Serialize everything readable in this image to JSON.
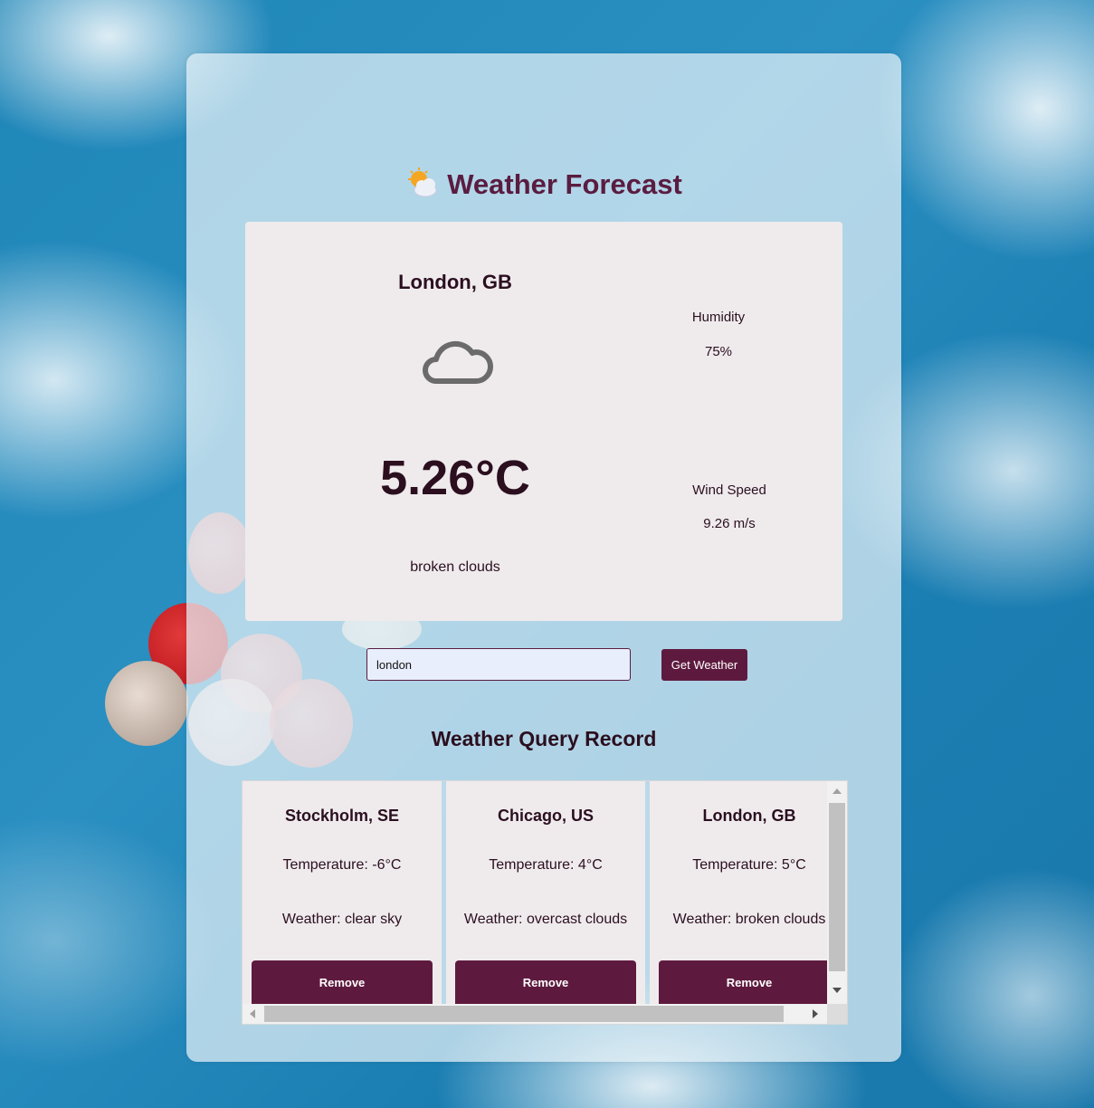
{
  "app": {
    "title": "Weather Forecast",
    "title_icon": "sun-behind-cloud-icon"
  },
  "current": {
    "city": "London, GB",
    "icon": "cloud-icon",
    "temperature": "5.26°C",
    "description": "broken clouds",
    "humidity_label": "Humidity",
    "humidity_value": "75%",
    "wind_label": "Wind Speed",
    "wind_value": "9.26 m/s"
  },
  "search": {
    "value": "london",
    "button_label": "Get Weather"
  },
  "records": {
    "title": "Weather Query Record",
    "items": [
      {
        "city": "Stockholm, SE",
        "temperature": "Temperature: -6°C",
        "weather": "Weather: clear sky",
        "remove_label": "Remove"
      },
      {
        "city": "Chicago, US",
        "temperature": "Temperature: 4°C",
        "weather": "Weather: overcast clouds",
        "remove_label": "Remove"
      },
      {
        "city": "London, GB",
        "temperature": "Temperature: 5°C",
        "weather": "Weather: broken clouds",
        "remove_label": "Remove"
      }
    ]
  },
  "colors": {
    "accent": "#5e1a3e",
    "title": "#5a1c40",
    "card": "#efebed",
    "text": "#2b0f1f",
    "input_bg": "#e8eefc"
  }
}
